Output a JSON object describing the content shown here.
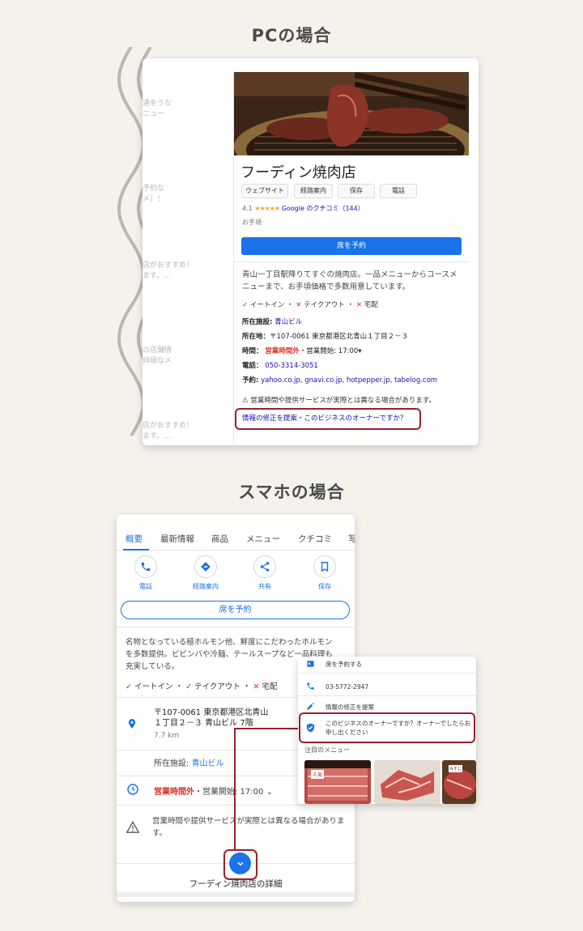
{
  "pc": {
    "title": "PCの場合",
    "ghost_texts": [
      "通をうな",
      "ニュー",
      "予約な",
      "メ］！",
      "店がおすすめ！",
      "ます。…",
      "の店舗情",
      "詳細なメ",
      "店がおすすめ！",
      "ます。…"
    ],
    "business_name": "フーディン焼肉店",
    "chips": [
      "ウェブサイト",
      "経路案内",
      "保存",
      "電話"
    ],
    "rating_value": "4.1",
    "rating_stars": "★★★★★",
    "reviews_link": "Google のクチコミ（144）",
    "price_label": "お手頃",
    "reserve_button": "席を予約",
    "description": "青山一丁目駅降りてすぐの焼肉店。一品メニューからコースメニューまで、お手頃価格で多数用意しています。",
    "services": {
      "dine_in": "イートイン",
      "takeout": "テイクアウト",
      "delivery": "宅配",
      "sep": "・"
    },
    "facility_label": "所在施設:",
    "facility_value": "青山ビル",
    "address_label": "所在地：",
    "address_value": "〒107-0061 東京都港区北青山１丁目２－３",
    "hours_label": "時間：",
    "hours_status": "営業時間外",
    "hours_open": "・営業開始: 17:00",
    "phone_label": "電話：",
    "phone_value": "050-3314-3051",
    "booking_label": "予約:",
    "booking_value": "yahoo.co.jp, gnavi.co.jp, hotpepper.jp, tabelog.com",
    "warning": "営業時間や提供サービスが実際とは異なる場合があります。",
    "suggest": "情報の修正を提案・このビジネスのオーナーですか？"
  },
  "sp": {
    "title": "スマホの場合",
    "tabs": [
      "概要",
      "最新情報",
      "商品",
      "メニュー",
      "クチコミ",
      "写"
    ],
    "actions": [
      "電話",
      "経路案内",
      "共有",
      "保存"
    ],
    "reserve_button": "席を予約",
    "description": "名物となっている極ホルモン他、鮮度にこだわったホルモンを多数提供。ビビンバや冷麺、テールスープなど一品料理も充実している。",
    "services": {
      "dine_in": "イートイン",
      "takeout": "テイクアウト",
      "delivery": "宅配",
      "sep": "・"
    },
    "address_line1": "〒107-0061 東京都港区北青山",
    "address_line2": "１丁目２－３ 青山ビル 7階",
    "distance": "7.7 km",
    "facility_label": "所在施設:",
    "facility_value": "青山ビル",
    "hours_status": "営業時間外",
    "hours_open": "・営業開始: 17:00",
    "warning": "営業時間や提供サービスが実際とは異なる場合があります。",
    "detail_title": "フーディン焼肉店の詳細",
    "popup": {
      "reserve": "席を予約する",
      "phone": "03-5772-2947",
      "suggest": "情報の修正を提案",
      "owner": "このビジネスのオーナーですか？オーナーでしたらお申し出ください",
      "menu_title": "注目のメニュー",
      "food_tag_1": "人気",
      "food_tag_2": "みすじ"
    }
  },
  "colors": {
    "accent_blue": "#1a73e8",
    "highlight_red": "#9b1f2e",
    "closed_red": "#d93025"
  }
}
